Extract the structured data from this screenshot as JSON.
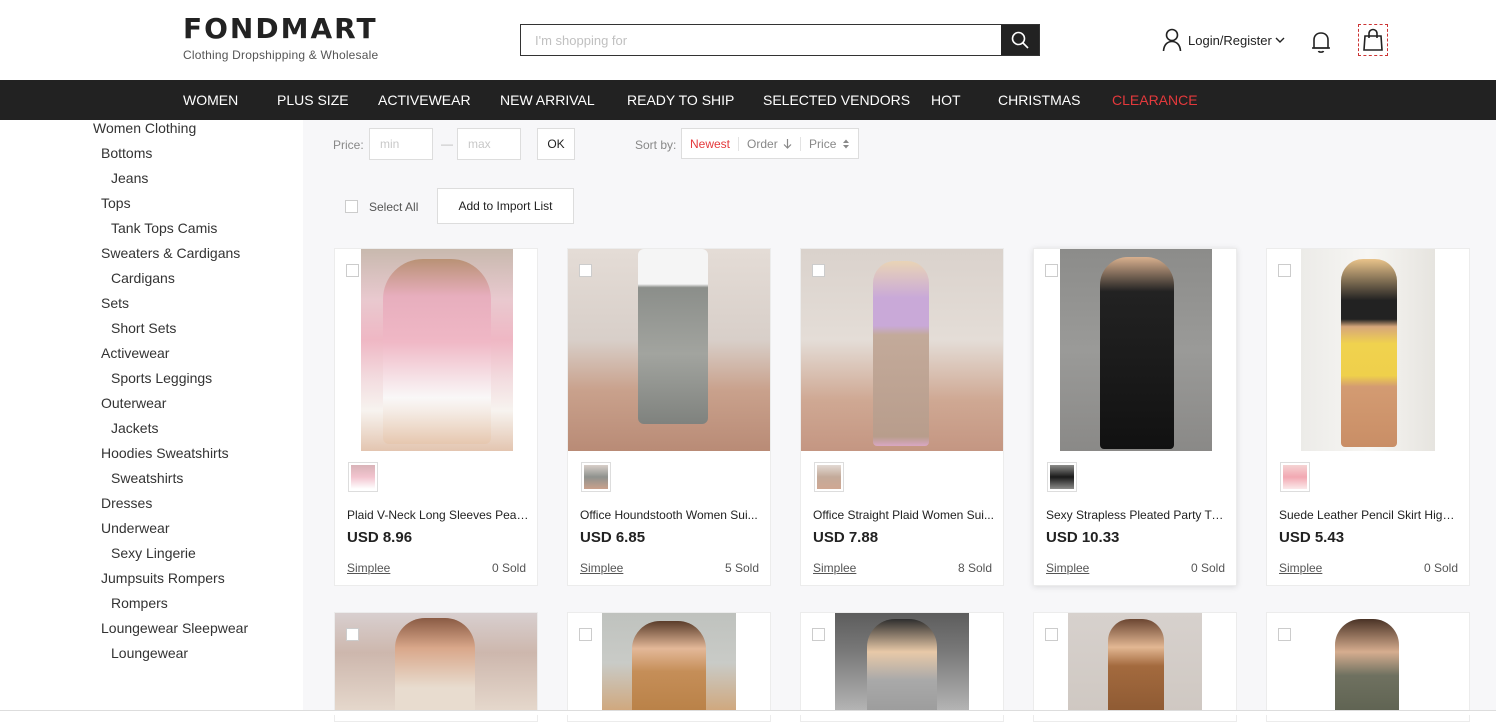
{
  "header": {
    "logo_text": "FONDMART",
    "logo_sub": "Clothing Dropshipping & Wholesale",
    "search_placeholder": "I'm shopping for",
    "account_label": "Login/Register",
    "icons": [
      "search-icon",
      "user-icon",
      "chevron-down-icon",
      "bell-icon",
      "shopping-bag-icon"
    ]
  },
  "nav": {
    "items": [
      {
        "label": "WOMEN"
      },
      {
        "label": "PLUS SIZE"
      },
      {
        "label": "ACTIVEWEAR"
      },
      {
        "label": "NEW ARRIVAL"
      },
      {
        "label": "READY TO SHIP"
      },
      {
        "label": "SELECTED VENDORS"
      },
      {
        "label": "HOT"
      },
      {
        "label": "CHRISTMAS"
      },
      {
        "label": "CLEARANCE",
        "color": "#e4393c"
      }
    ]
  },
  "sidebar": {
    "categories": [
      {
        "label": "Women Clothing",
        "level": 0
      },
      {
        "label": "Bottoms",
        "level": 1
      },
      {
        "label": "Jeans",
        "level": 2
      },
      {
        "label": "Tops",
        "level": 1
      },
      {
        "label": "Tank Tops Camis",
        "level": 2
      },
      {
        "label": "Sweaters & Cardigans",
        "level": 1
      },
      {
        "label": "Cardigans",
        "level": 2
      },
      {
        "label": "Sets",
        "level": 1
      },
      {
        "label": "Short Sets",
        "level": 2
      },
      {
        "label": "Activewear",
        "level": 1
      },
      {
        "label": "Sports Leggings",
        "level": 2
      },
      {
        "label": "Outerwear",
        "level": 1
      },
      {
        "label": "Jackets",
        "level": 2
      },
      {
        "label": "Hoodies Sweatshirts",
        "level": 1
      },
      {
        "label": "Sweatshirts",
        "level": 2
      },
      {
        "label": "Dresses",
        "level": 1
      },
      {
        "label": "Underwear",
        "level": 1
      },
      {
        "label": "Sexy Lingerie",
        "level": 2
      },
      {
        "label": "Jumpsuits Rompers",
        "level": 1
      },
      {
        "label": "Rompers",
        "level": 2
      },
      {
        "label": "Loungewear Sleepwear",
        "level": 1
      },
      {
        "label": "Loungewear",
        "level": 2
      }
    ]
  },
  "filters": {
    "price_label": "Price:",
    "min_placeholder": "min",
    "max_placeholder": "max",
    "dash": "—",
    "ok_label": "OK",
    "sort_label": "Sort by:",
    "sort_newest": "Newest",
    "sort_order": "Order",
    "sort_price": "Price",
    "accent_color": "#e4393c"
  },
  "bulk": {
    "select_all_label": "Select All",
    "import_label": "Add to Import List"
  },
  "products": [
    {
      "title": "Plaid V-Neck Long Sleeves Pearl...",
      "price": "USD 8.96",
      "vendor": "Simplee",
      "sold": "0 Sold"
    },
    {
      "title": "Office Houndstooth Women Sui...",
      "price": "USD 6.85",
      "vendor": "Simplee",
      "sold": "5 Sold"
    },
    {
      "title": "Office Straight Plaid Women Sui...",
      "price": "USD 7.88",
      "vendor": "Simplee",
      "sold": "8 Sold"
    },
    {
      "title": "Sexy Strapless Pleated Party Tu...",
      "price": "USD 10.33",
      "vendor": "Simplee",
      "sold": "0 Sold"
    },
    {
      "title": "Suede Leather Pencil Skirt High ...",
      "price": "USD 5.43",
      "vendor": "Simplee",
      "sold": "0 Sold"
    }
  ]
}
